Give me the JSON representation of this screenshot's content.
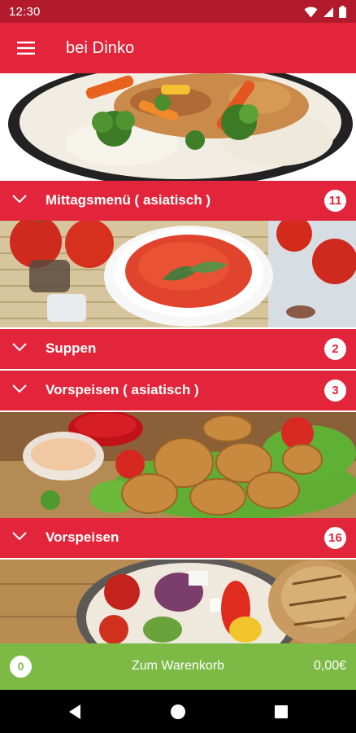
{
  "status_bar": {
    "time": "12:30",
    "icons": [
      "wifi-icon",
      "signal-icon",
      "battery-icon"
    ]
  },
  "app_bar": {
    "title": "bei Dinko",
    "menu_icon": "hamburger-menu-icon"
  },
  "categories": [
    {
      "label": "Mittagsmenü ( asiatisch )",
      "count": "11"
    },
    {
      "label": "Suppen",
      "count": "2"
    },
    {
      "label": "Vorspeisen ( asiatisch )",
      "count": "3"
    },
    {
      "label": "Vorspeisen",
      "count": "16"
    }
  ],
  "cart": {
    "count": "0",
    "label": "Zum Warenkorb",
    "total": "0,00€"
  },
  "nav": [
    "back-icon",
    "home-icon",
    "recents-icon"
  ],
  "colors": {
    "primary": "#e2253a",
    "status_bar": "#b31b2c",
    "cart": "#7cba45"
  }
}
